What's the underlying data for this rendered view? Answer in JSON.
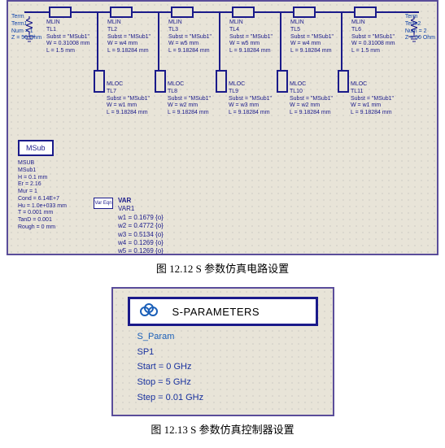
{
  "figure1": {
    "caption": "图 12.12 S 参数仿真电路设置",
    "term1": {
      "name": "Term",
      "id": "Term1",
      "num": "Num = 1",
      "z": "Z = 50 Ohm"
    },
    "term2": {
      "name": "Term",
      "id": "Term2",
      "num": "Num = 2",
      "z": "Z = 50 Ohm"
    },
    "tl": [
      {
        "name": "MLIN",
        "id": "TL1",
        "sub": "Subst = \"MSub1\"",
        "w": "W = 0.31008 mm",
        "l": "L = 1.5 mm"
      },
      {
        "name": "MLIN",
        "id": "TL2",
        "sub": "Subst = \"MSub1\"",
        "w": "W = w4 mm",
        "l": "L = 9.18284 mm"
      },
      {
        "name": "MLIN",
        "id": "TL3",
        "sub": "Subst = \"MSub1\"",
        "w": "W = w5 mm",
        "l": "L = 9.18284 mm"
      },
      {
        "name": "MLIN",
        "id": "TL4",
        "sub": "Subst = \"MSub1\"",
        "w": "W = w5 mm",
        "l": "L = 9.18284 mm"
      },
      {
        "name": "MLIN",
        "id": "TL5",
        "sub": "Subst = \"MSub1\"",
        "w": "W = w4 mm",
        "l": "L = 9.18284 mm"
      },
      {
        "name": "MLIN",
        "id": "TL6",
        "sub": "Subst = \"MSub1\"",
        "w": "W = 0.31008 mm",
        "l": "L = 1.5 mm"
      }
    ],
    "mloc": [
      {
        "name": "MLOC",
        "id": "TL7",
        "sub": "Subst = \"MSub1\"",
        "w": "W = w1 mm",
        "l": "L = 9.18284 mm"
      },
      {
        "name": "MLOC",
        "id": "TL8",
        "sub": "Subst = \"MSub1\"",
        "w": "W = w2 mm",
        "l": "L = 9.18284 mm"
      },
      {
        "name": "MLOC",
        "id": "TL9",
        "sub": "Subst = \"MSub1\"",
        "w": "W = w3 mm",
        "l": "L = 9.18284 mm"
      },
      {
        "name": "MLOC",
        "id": "TL10",
        "sub": "Subst = \"MSub1\"",
        "w": "W = w2 mm",
        "l": "L = 9.18284 mm"
      },
      {
        "name": "MLOC",
        "id": "TL11",
        "sub": "Subst = \"MSub1\"",
        "w": "W = w1 mm",
        "l": "L = 9.18284 mm"
      }
    ],
    "msub": {
      "btn": "MSub",
      "title": "MSUB",
      "id": "MSub1",
      "h": "H = 0.1 mm",
      "er": "Er = 2.16",
      "mur": "Mur = 1",
      "cond": "Cond = 6.14E+7",
      "hu": "Hu = 1.0e+033 mm",
      "t": "T = 0.001 mm",
      "tand": "TanD = 0.001",
      "rough": "Rough = 0 mm"
    },
    "var": {
      "icon": "Var Eqn",
      "title": "VAR",
      "id": "VAR1",
      "w1": "w1 = 0.1679 {o}",
      "w2": "w2 = 0.4772 {o}",
      "w3": "w3 = 0.5134 {o}",
      "w4": "w4 = 0.1269 {o}",
      "w5": "w5 = 0.1269 {o}"
    }
  },
  "figure2": {
    "caption": "图 12.13   S 参数仿真控制器设置",
    "header": "S-PARAMETERS",
    "name": "S_Param",
    "id": "SP1",
    "start": "Start = 0 GHz",
    "stop": "Stop = 5 GHz",
    "step": "Step = 0.01 GHz"
  }
}
